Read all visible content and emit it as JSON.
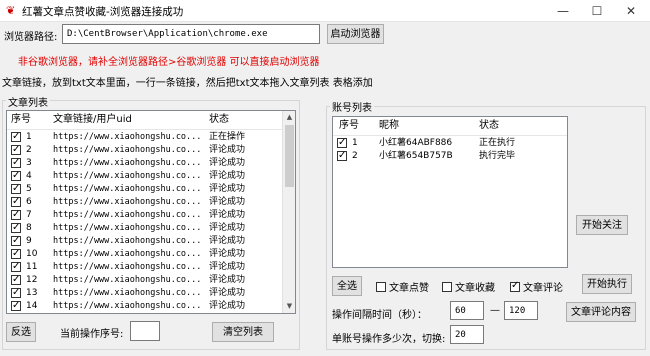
{
  "window": {
    "title": "红薯文章点赞收藏-浏览器连接成功",
    "minimize": "—",
    "maximize": "☐",
    "close": "✕"
  },
  "browser": {
    "path_label": "浏览器路径:",
    "path_value": "D:\\CentBrowser\\Application\\chrome.exe",
    "launch_button": "启动浏览器",
    "warning": "非谷歌浏览器，请补全浏览器路径>谷歌浏览器 可以直接启动浏览器",
    "instruction": "文章链接，放到txt文本里面，一行一条链接，然后把txt文本拖入文章列表 表格添加"
  },
  "articles": {
    "group_title": "文章列表",
    "columns": [
      "序号",
      "文章链接/用户uid",
      "状态"
    ],
    "rows": [
      {
        "no": "1",
        "link": "https://www.xiaohongshu.co...",
        "status": "正在操作",
        "checked": true
      },
      {
        "no": "2",
        "link": "https://www.xiaohongshu.co...",
        "status": "评论成功",
        "checked": true
      },
      {
        "no": "3",
        "link": "https://www.xiaohongshu.co...",
        "status": "评论成功",
        "checked": true
      },
      {
        "no": "4",
        "link": "https://www.xiaohongshu.co...",
        "status": "评论成功",
        "checked": true
      },
      {
        "no": "5",
        "link": "https://www.xiaohongshu.co...",
        "status": "评论成功",
        "checked": true
      },
      {
        "no": "6",
        "link": "https://www.xiaohongshu.co...",
        "status": "评论成功",
        "checked": true
      },
      {
        "no": "7",
        "link": "https://www.xiaohongshu.co...",
        "status": "评论成功",
        "checked": true
      },
      {
        "no": "8",
        "link": "https://www.xiaohongshu.co...",
        "status": "评论成功",
        "checked": true
      },
      {
        "no": "9",
        "link": "https://www.xiaohongshu.co...",
        "status": "评论成功",
        "checked": true
      },
      {
        "no": "10",
        "link": "https://www.xiaohongshu.co...",
        "status": "评论成功",
        "checked": true
      },
      {
        "no": "11",
        "link": "https://www.xiaohongshu.co...",
        "status": "评论成功",
        "checked": true
      },
      {
        "no": "12",
        "link": "https://www.xiaohongshu.co...",
        "status": "评论成功",
        "checked": true
      },
      {
        "no": "13",
        "link": "https://www.xiaohongshu.co...",
        "status": "评论成功",
        "checked": true
      },
      {
        "no": "14",
        "link": "https://www.xiaohongshu.co...",
        "status": "评论成功",
        "checked": true
      }
    ],
    "invert_button": "反选",
    "current_label": "当前操作序号:",
    "current_value": "",
    "clear_button": "清空列表"
  },
  "accounts": {
    "group_title": "账号列表",
    "columns": [
      "序号",
      "昵称",
      "状态"
    ],
    "rows": [
      {
        "no": "1",
        "nick": "小红薯64ABF886",
        "status": "正在执行",
        "checked": true
      },
      {
        "no": "2",
        "nick": "小红薯654B757B",
        "status": "执行完毕",
        "checked": true
      }
    ],
    "follow_button": "开始关注",
    "select_all_button": "全选",
    "options": [
      {
        "label": "文章点赞",
        "checked": false
      },
      {
        "label": "文章收藏",
        "checked": false
      },
      {
        "label": "文章评论",
        "checked": true
      }
    ],
    "start_button": "开始执行",
    "interval_label": "操作间隔时间（秒）：",
    "interval_min": "60",
    "interval_dash": "—",
    "interval_max": "120",
    "comment_content_button": "文章评论内容",
    "switch_label": "单账号操作多少次，切换:",
    "switch_value": "20"
  }
}
